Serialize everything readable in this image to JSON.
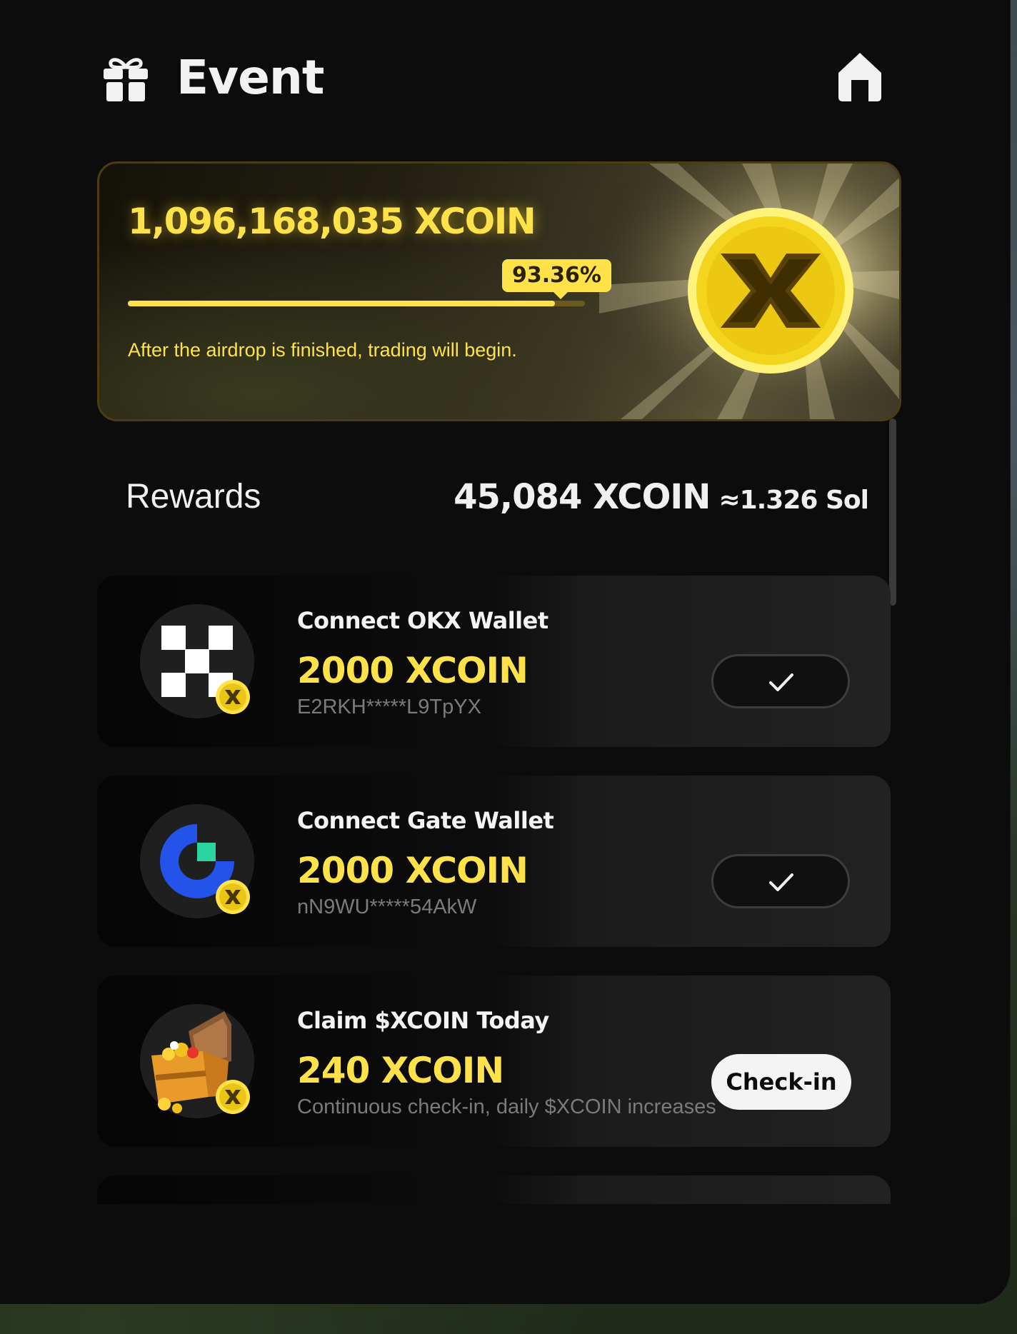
{
  "header": {
    "title": "Event"
  },
  "banner": {
    "total": "1,096,168,035 XCOIN",
    "progress_label": "93.36%",
    "progress_fraction": 0.9336,
    "note": "After the airdrop is finished, trading will begin."
  },
  "rewards": {
    "label": "Rewards",
    "amount": "45,084 XCOIN",
    "sol": "≈1.326 Sol"
  },
  "tasks": [
    {
      "title": "Connect OKX Wallet",
      "reward": "2000 XCOIN",
      "sub": "E2RKH*****L9TpYX",
      "status": "done",
      "icon": "okx-logo-icon"
    },
    {
      "title": "Connect Gate Wallet",
      "reward": "2000 XCOIN",
      "sub": "nN9WU*****54AkW",
      "status": "done",
      "icon": "gate-logo-icon"
    },
    {
      "title": "Claim $XCOIN Today",
      "reward": "240 XCOIN",
      "sub": "Continuous check-in, daily $XCOIN increases",
      "action_label": "Check-in",
      "icon": "treasure-chest-icon"
    }
  ],
  "colors": {
    "accent": "#ffe24a",
    "panel": "#0c0c0c"
  }
}
